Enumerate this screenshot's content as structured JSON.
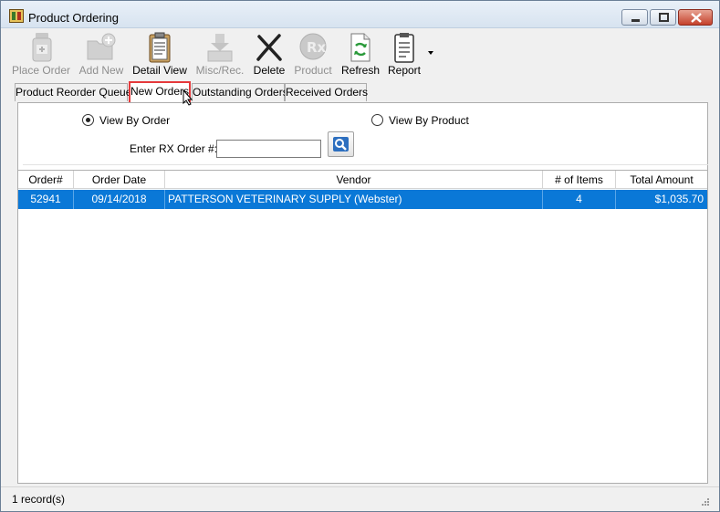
{
  "window": {
    "title": "Product Ordering"
  },
  "toolbar": {
    "items": [
      {
        "label": "Place Order",
        "icon": "medicine-bottle-icon",
        "enabled": false
      },
      {
        "label": "Add New",
        "icon": "add-folder-icon",
        "enabled": false
      },
      {
        "label": "Detail View",
        "icon": "clipboard-icon",
        "enabled": true
      },
      {
        "label": "Misc/Rec.",
        "icon": "receive-tray-icon",
        "enabled": false
      },
      {
        "label": "Delete",
        "icon": "delete-x-icon",
        "enabled": true
      },
      {
        "label": "Product",
        "icon": "rx-icon",
        "enabled": false
      },
      {
        "label": "Refresh",
        "icon": "refresh-icon",
        "enabled": true
      },
      {
        "label": "Report",
        "icon": "report-icon",
        "enabled": true
      }
    ]
  },
  "tabs": [
    {
      "label": "Product Reorder Queue",
      "active": false
    },
    {
      "label": "New Orders",
      "active": true
    },
    {
      "label": "Outstanding Orders",
      "active": false
    },
    {
      "label": "Received Orders",
      "active": false
    }
  ],
  "filter": {
    "view_by_order": "View By Order",
    "view_by_order_checked": true,
    "view_by_product": "View By Product",
    "view_by_product_checked": false,
    "rx_label": "Enter RX Order #:",
    "rx_value": ""
  },
  "grid": {
    "columns": [
      "Order#",
      "Order Date",
      "Vendor",
      "# of Items",
      "Total Amount"
    ],
    "rows": [
      {
        "order": "52941",
        "date": "09/14/2018",
        "vendor": "PATTERSON VETERINARY SUPPLY (Webster)",
        "items": "4",
        "total": "$1,035.70",
        "selected": true
      }
    ]
  },
  "status": {
    "text": "1 record(s)"
  },
  "colors": {
    "selection": "#0a78d7",
    "active_tab_highlight": "#e5393b"
  }
}
